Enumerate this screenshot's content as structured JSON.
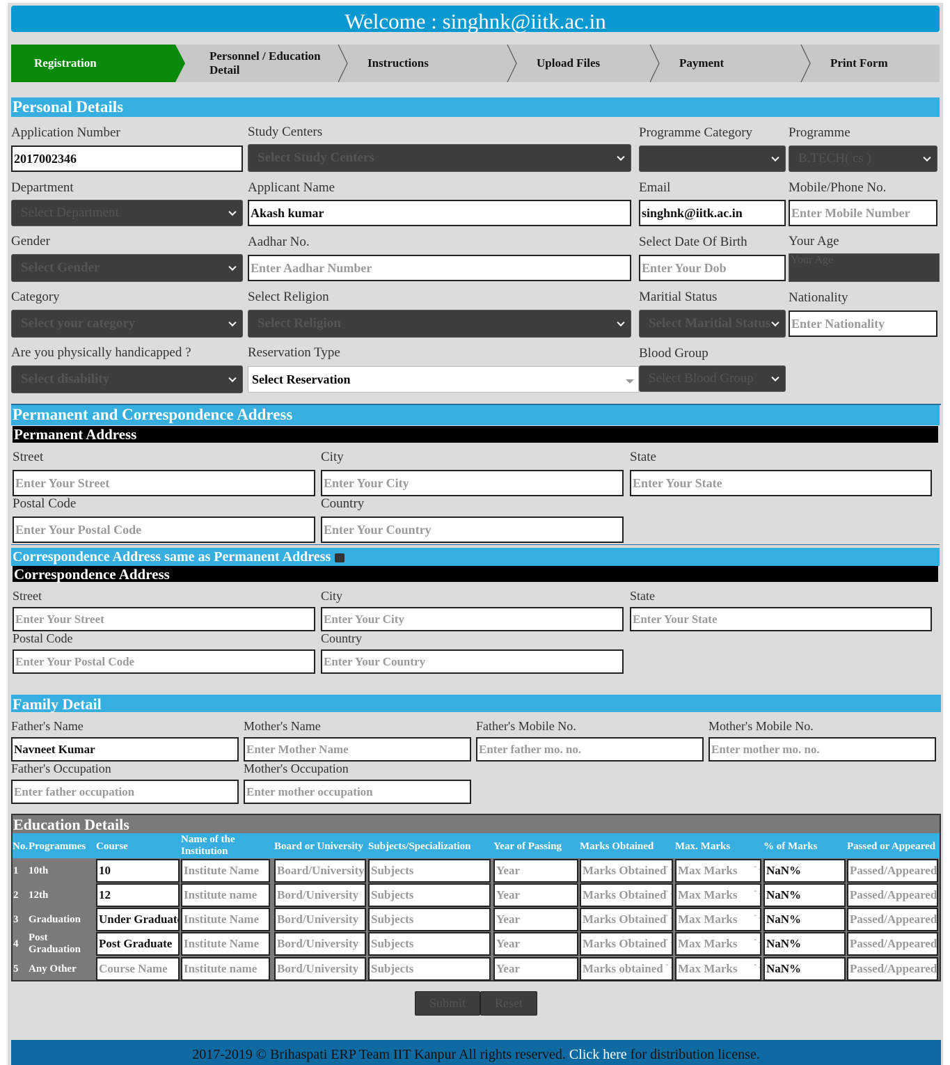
{
  "welcome": "Welcome : singhnk@iitk.ac.in",
  "steps": [
    "Registration",
    "Personnel / Education Detail",
    "Instructions",
    "Upload Files",
    "Payment",
    "Print Form"
  ],
  "personal": {
    "title": "Personal Details",
    "application_number": {
      "label": "Application Number",
      "value": "2017002346"
    },
    "study_centers": {
      "label": "Study Centers",
      "value": "Select Study Centers"
    },
    "programme_category": {
      "label": "Programme Category",
      "value": ""
    },
    "programme": {
      "label": "Programme",
      "value": "B.TECH( cs )"
    },
    "department": {
      "label": "Department",
      "value": "Select Department"
    },
    "applicant_name": {
      "label": "Applicant Name",
      "value": "Akash kumar"
    },
    "email": {
      "label": "Email",
      "value": "singhnk@iitk.ac.in"
    },
    "mobile": {
      "label": "Mobile/Phone No.",
      "placeholder": "Enter Mobile Number"
    },
    "gender": {
      "label": "Gender",
      "value": "Select Gender"
    },
    "aadhar": {
      "label": "Aadhar No.",
      "placeholder": "Enter Aadhar Number"
    },
    "dob": {
      "label": "Select Date Of Birth",
      "placeholder": "Enter Your Dob"
    },
    "age": {
      "label": "Your Age",
      "placeholder": "Your Age"
    },
    "category": {
      "label": "Category",
      "value": "Select your category"
    },
    "religion": {
      "label": "Select Religion",
      "value": "Select Religion"
    },
    "marital": {
      "label": "Maritial Status",
      "value": "Select Maritial Status"
    },
    "nationality": {
      "label": "Nationality",
      "placeholder": "Enter Nationality"
    },
    "handicapped": {
      "label": "Are you physically handicapped ?",
      "value": "Select disability"
    },
    "reservation": {
      "label": "Reservation Type",
      "value": "Select Reservation"
    },
    "blood": {
      "label": "Blood Group",
      "value": "Select Blood Group"
    }
  },
  "address": {
    "title": "Permanent and Correspondence Address",
    "permanent_title": "Permanent Address",
    "same_as": "Correspondence Address same as Permanent Address",
    "correspondence_title": "Correspondence Address",
    "labels": {
      "street": "Street",
      "city": "City",
      "state": "State",
      "postal": "Postal Code",
      "country": "Country"
    },
    "placeholders": {
      "street": "Enter Your Street",
      "city": "Enter Your City",
      "state": "Enter Your State",
      "postal": "Enter Your Postal Code",
      "country": "Enter Your Country"
    }
  },
  "family": {
    "title": "Family Detail",
    "father_name": {
      "label": "Father's Name",
      "value": "Navneet Kumar"
    },
    "mother_name": {
      "label": "Mother's Name",
      "placeholder": "Enter Mother Name"
    },
    "father_mobile": {
      "label": "Father's Mobile No.",
      "placeholder": "Enter father mo. no."
    },
    "mother_mobile": {
      "label": "Mother's Mobile No.",
      "placeholder": "Enter mother mo. no."
    },
    "father_occupation": {
      "label": "Father's Occupation",
      "placeholder": "Enter father occupation"
    },
    "mother_occupation": {
      "label": "Mother's Occupation",
      "placeholder": "Enter mother occupation"
    }
  },
  "education": {
    "title": "Education Details",
    "headers": [
      "No.",
      "Programmes",
      "Course",
      "Name of the Institution",
      "Board or University",
      "Subjects/Specialization",
      "Year of Passing",
      "Marks Obtained",
      "Max. Marks",
      "% of Marks",
      "Passed or Appeared"
    ],
    "rows": [
      {
        "no": "1",
        "programme": "10th",
        "course": "10",
        "course_ph": false,
        "institute": "Institute Name",
        "board": "Board/University",
        "subjects": "Subjects",
        "year": "Year",
        "marks": "Marks Obtained",
        "max": "Max Marks",
        "pct": "NaN%",
        "passed": "Passed/Appeared"
      },
      {
        "no": "2",
        "programme": "12th",
        "course": "12",
        "course_ph": false,
        "institute": "Institute name",
        "board": "Bord/University",
        "subjects": "Subjects",
        "year": "Year",
        "marks": "Marks Obtained",
        "max": "Max Marks",
        "pct": "NaN%",
        "passed": "Passed/Appeared"
      },
      {
        "no": "3",
        "programme": "Graduation",
        "course": "Under Graduate",
        "course_ph": false,
        "institute": "Institute Name",
        "board": "Bord/University",
        "subjects": "Subjects",
        "year": "Year",
        "marks": "Marks Obtained",
        "max": "Max Marks",
        "pct": "NaN%",
        "passed": "Passed/Appeared"
      },
      {
        "no": "4",
        "programme": "Post Graduation",
        "course": "Post Graduate",
        "course_ph": false,
        "institute": "Institute Name",
        "board": "Bord/University",
        "subjects": "Subjects",
        "year": "Year",
        "marks": "Marks Obtained",
        "max": "Max Marks",
        "pct": "NaN%",
        "passed": "Passed/Appeared"
      },
      {
        "no": "5",
        "programme": "Any Other",
        "course": "Course Name",
        "course_ph": true,
        "institute": "Institute name",
        "board": "Bord/University",
        "subjects": "Subjects",
        "year": "Year",
        "marks": "Marks obtained",
        "max": "Max Marks",
        "pct": "NaN%",
        "passed": "Passed/Appeared"
      }
    ]
  },
  "buttons": {
    "submit": "Submit",
    "reset": "Reset"
  },
  "footer": {
    "prefix": "2017-2019 © ",
    "brand": "Brihaspati ERP Team IIT Kanpur",
    "middle": " All rights reserved. ",
    "link": "Click here",
    "suffix": " for distribution license."
  }
}
